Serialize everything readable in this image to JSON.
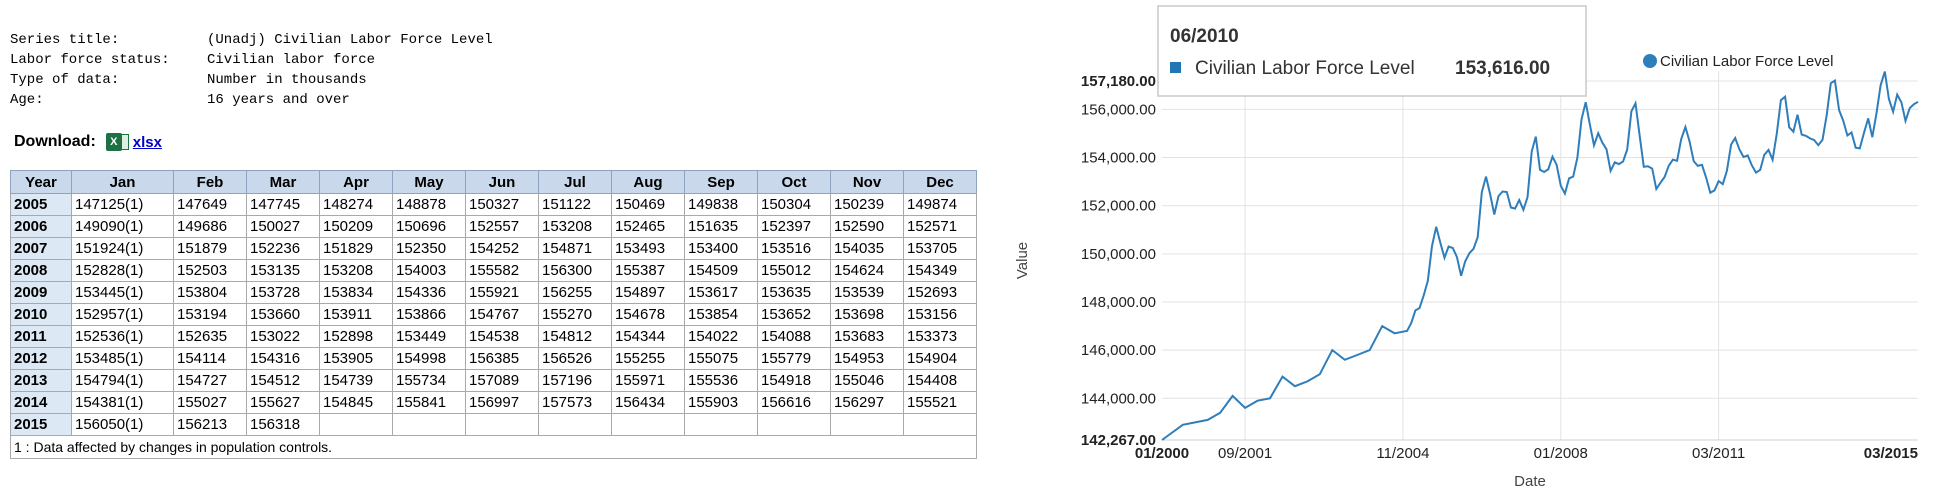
{
  "meta": {
    "rows": [
      {
        "key": "Series title:",
        "value": "(Unadj) Civilian Labor Force Level"
      },
      {
        "key": "Labor force status:",
        "value": "Civilian labor force"
      },
      {
        "key": "Type of data:",
        "value": "Number in thousands"
      },
      {
        "key": "Age:",
        "value": "16 years and over"
      }
    ]
  },
  "download": {
    "label": "Download:",
    "link": "xlsx"
  },
  "table": {
    "headers": [
      "Year",
      "Jan",
      "Feb",
      "Mar",
      "Apr",
      "May",
      "Jun",
      "Jul",
      "Aug",
      "Sep",
      "Oct",
      "Nov",
      "Dec"
    ],
    "rows": [
      [
        "2005",
        "147125(1)",
        "147649",
        "147745",
        "148274",
        "148878",
        "150327",
        "151122",
        "150469",
        "149838",
        "150304",
        "150239",
        "149874"
      ],
      [
        "2006",
        "149090(1)",
        "149686",
        "150027",
        "150209",
        "150696",
        "152557",
        "153208",
        "152465",
        "151635",
        "152397",
        "152590",
        "152571"
      ],
      [
        "2007",
        "151924(1)",
        "151879",
        "152236",
        "151829",
        "152350",
        "154252",
        "154871",
        "153493",
        "153400",
        "153516",
        "154035",
        "153705"
      ],
      [
        "2008",
        "152828(1)",
        "152503",
        "153135",
        "153208",
        "154003",
        "155582",
        "156300",
        "155387",
        "154509",
        "155012",
        "154624",
        "154349"
      ],
      [
        "2009",
        "153445(1)",
        "153804",
        "153728",
        "153834",
        "154336",
        "155921",
        "156255",
        "154897",
        "153617",
        "153635",
        "153539",
        "152693"
      ],
      [
        "2010",
        "152957(1)",
        "153194",
        "153660",
        "153911",
        "153866",
        "154767",
        "155270",
        "154678",
        "153854",
        "153652",
        "153698",
        "153156"
      ],
      [
        "2011",
        "152536(1)",
        "152635",
        "153022",
        "152898",
        "153449",
        "154538",
        "154812",
        "154344",
        "154022",
        "154088",
        "153683",
        "153373"
      ],
      [
        "2012",
        "153485(1)",
        "154114",
        "154316",
        "153905",
        "154998",
        "156385",
        "156526",
        "155255",
        "155075",
        "155779",
        "154953",
        "154904"
      ],
      [
        "2013",
        "154794(1)",
        "154727",
        "154512",
        "154739",
        "155734",
        "157089",
        "157196",
        "155971",
        "155536",
        "154918",
        "155046",
        "154408"
      ],
      [
        "2014",
        "154381(1)",
        "155027",
        "155627",
        "154845",
        "155841",
        "156997",
        "157573",
        "156434",
        "155903",
        "156616",
        "156297",
        "155521"
      ],
      [
        "2015",
        "156050(1)",
        "156213",
        "156318",
        "",
        "",
        "",
        "",
        "",
        "",
        "",
        "",
        ""
      ]
    ],
    "footnote": "1 : Data affected by changes in population controls."
  },
  "tooltip": {
    "date": "06/2010",
    "series": "Civilian Labor Force Level",
    "value": "153,616.00",
    "color": "#1f77b4"
  },
  "chart_data": {
    "type": "line",
    "xlabel": "Date",
    "ylabel": "Value",
    "legend": "top-right",
    "color": "#2f7ebc",
    "x_range": [
      "01/2000",
      "03/2015"
    ],
    "ylim": [
      142267,
      157180
    ],
    "y_ticks": [
      "157,180.00",
      "156,000.00",
      "154,000.00",
      "152,000.00",
      "150,000.00",
      "148,000.00",
      "146,000.00",
      "144,000.00",
      "142,267.00"
    ],
    "x_ticks": [
      "01/2000",
      "09/2001",
      "11/2004",
      "01/2008",
      "03/2011",
      "03/2015"
    ],
    "x_ticks_bold": [
      "01/2000",
      "03/2015"
    ],
    "grid": true,
    "series": [
      {
        "name": "Civilian Labor Force Level",
        "anchors": [
          [
            "2000-01",
            142267
          ],
          [
            "2000-06",
            142900
          ],
          [
            "2000-12",
            143100
          ],
          [
            "2001-03",
            143400
          ],
          [
            "2001-06",
            144100
          ],
          [
            "2001-09",
            143600
          ],
          [
            "2001-12",
            143900
          ],
          [
            "2002-03",
            144000
          ],
          [
            "2002-06",
            144900
          ],
          [
            "2002-09",
            144500
          ],
          [
            "2002-12",
            144700
          ],
          [
            "2003-03",
            145000
          ],
          [
            "2003-06",
            146000
          ],
          [
            "2003-09",
            145600
          ],
          [
            "2003-12",
            145800
          ],
          [
            "2004-03",
            146000
          ],
          [
            "2004-06",
            147000
          ],
          [
            "2004-09",
            146700
          ],
          [
            "2004-12",
            146800
          ],
          [
            "2005-01",
            147125
          ],
          [
            "2005-02",
            147649
          ],
          [
            "2005-03",
            147745
          ],
          [
            "2005-04",
            148274
          ],
          [
            "2005-05",
            148878
          ],
          [
            "2005-06",
            150327
          ],
          [
            "2005-07",
            151122
          ],
          [
            "2005-08",
            150469
          ],
          [
            "2005-09",
            149838
          ],
          [
            "2005-10",
            150304
          ],
          [
            "2005-11",
            150239
          ],
          [
            "2005-12",
            149874
          ],
          [
            "2006-01",
            149090
          ],
          [
            "2006-02",
            149686
          ],
          [
            "2006-03",
            150027
          ],
          [
            "2006-04",
            150209
          ],
          [
            "2006-05",
            150696
          ],
          [
            "2006-06",
            152557
          ],
          [
            "2006-07",
            153208
          ],
          [
            "2006-08",
            152465
          ],
          [
            "2006-09",
            151635
          ],
          [
            "2006-10",
            152397
          ],
          [
            "2006-11",
            152590
          ],
          [
            "2006-12",
            152571
          ],
          [
            "2007-01",
            151924
          ],
          [
            "2007-02",
            151879
          ],
          [
            "2007-03",
            152236
          ],
          [
            "2007-04",
            151829
          ],
          [
            "2007-05",
            152350
          ],
          [
            "2007-06",
            154252
          ],
          [
            "2007-07",
            154871
          ],
          [
            "2007-08",
            153493
          ],
          [
            "2007-09",
            153400
          ],
          [
            "2007-10",
            153516
          ],
          [
            "2007-11",
            154035
          ],
          [
            "2007-12",
            153705
          ],
          [
            "2008-01",
            152828
          ],
          [
            "2008-02",
            152503
          ],
          [
            "2008-03",
            153135
          ],
          [
            "2008-04",
            153208
          ],
          [
            "2008-05",
            154003
          ],
          [
            "2008-06",
            155582
          ],
          [
            "2008-07",
            156300
          ],
          [
            "2008-08",
            155387
          ],
          [
            "2008-09",
            154509
          ],
          [
            "2008-10",
            155012
          ],
          [
            "2008-11",
            154624
          ],
          [
            "2008-12",
            154349
          ],
          [
            "2009-01",
            153445
          ],
          [
            "2009-02",
            153804
          ],
          [
            "2009-03",
            153728
          ],
          [
            "2009-04",
            153834
          ],
          [
            "2009-05",
            154336
          ],
          [
            "2009-06",
            155921
          ],
          [
            "2009-07",
            156255
          ],
          [
            "2009-08",
            154897
          ],
          [
            "2009-09",
            153617
          ],
          [
            "2009-10",
            153635
          ],
          [
            "2009-11",
            153539
          ],
          [
            "2009-12",
            152693
          ],
          [
            "2010-01",
            152957
          ],
          [
            "2010-02",
            153194
          ],
          [
            "2010-03",
            153660
          ],
          [
            "2010-04",
            153911
          ],
          [
            "2010-05",
            153866
          ],
          [
            "2010-06",
            154767
          ],
          [
            "2010-07",
            155270
          ],
          [
            "2010-08",
            154678
          ],
          [
            "2010-09",
            153854
          ],
          [
            "2010-10",
            153652
          ],
          [
            "2010-11",
            153698
          ],
          [
            "2010-12",
            153156
          ],
          [
            "2011-01",
            152536
          ],
          [
            "2011-02",
            152635
          ],
          [
            "2011-03",
            153022
          ],
          [
            "2011-04",
            152898
          ],
          [
            "2011-05",
            153449
          ],
          [
            "2011-06",
            154538
          ],
          [
            "2011-07",
            154812
          ],
          [
            "2011-08",
            154344
          ],
          [
            "2011-09",
            154022
          ],
          [
            "2011-10",
            154088
          ],
          [
            "2011-11",
            153683
          ],
          [
            "2011-12",
            153373
          ],
          [
            "2012-01",
            153485
          ],
          [
            "2012-02",
            154114
          ],
          [
            "2012-03",
            154316
          ],
          [
            "2012-04",
            153905
          ],
          [
            "2012-05",
            154998
          ],
          [
            "2012-06",
            156385
          ],
          [
            "2012-07",
            156526
          ],
          [
            "2012-08",
            155255
          ],
          [
            "2012-09",
            155075
          ],
          [
            "2012-10",
            155779
          ],
          [
            "2012-11",
            154953
          ],
          [
            "2012-12",
            154904
          ],
          [
            "2013-01",
            154794
          ],
          [
            "2013-02",
            154727
          ],
          [
            "2013-03",
            154512
          ],
          [
            "2013-04",
            154739
          ],
          [
            "2013-05",
            155734
          ],
          [
            "2013-06",
            157089
          ],
          [
            "2013-07",
            157196
          ],
          [
            "2013-08",
            155971
          ],
          [
            "2013-09",
            155536
          ],
          [
            "2013-10",
            154918
          ],
          [
            "2013-11",
            155046
          ],
          [
            "2013-12",
            154408
          ],
          [
            "2014-01",
            154381
          ],
          [
            "2014-02",
            155027
          ],
          [
            "2014-03",
            155627
          ],
          [
            "2014-04",
            154845
          ],
          [
            "2014-05",
            155841
          ],
          [
            "2014-06",
            156997
          ],
          [
            "2014-07",
            157573
          ],
          [
            "2014-08",
            156434
          ],
          [
            "2014-09",
            155903
          ],
          [
            "2014-10",
            156616
          ],
          [
            "2014-11",
            156297
          ],
          [
            "2014-12",
            155521
          ],
          [
            "2015-01",
            156050
          ],
          [
            "2015-02",
            156213
          ],
          [
            "2015-03",
            156318
          ]
        ]
      }
    ]
  }
}
